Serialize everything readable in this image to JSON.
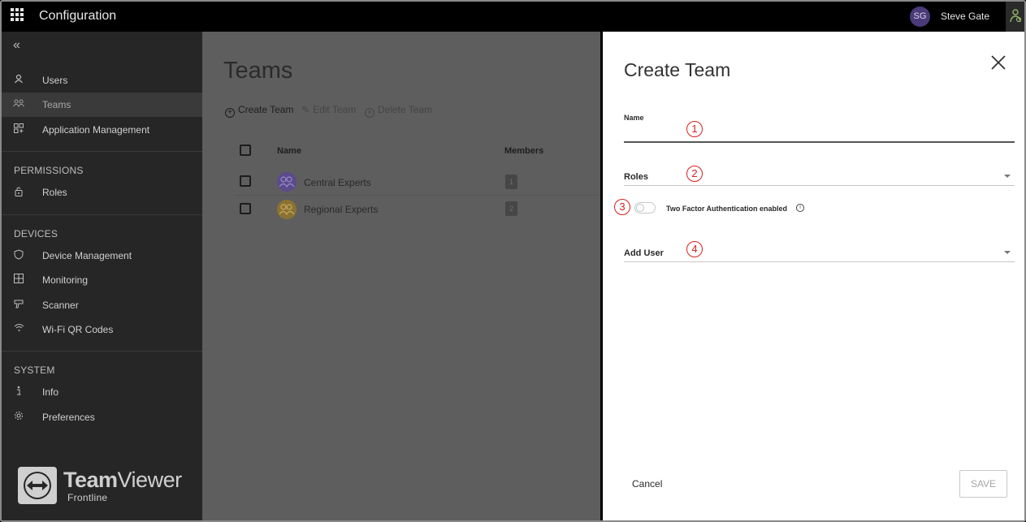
{
  "topbar": {
    "app_title": "Configuration",
    "avatar_initials": "SG",
    "user_name": "Steve Gate"
  },
  "sidebar": {
    "collapse_glyph": "«",
    "items": [
      {
        "label": "Users",
        "icon": "user-icon"
      },
      {
        "label": "Teams",
        "icon": "teams-icon",
        "active": true
      },
      {
        "label": "Application Management",
        "icon": "apps-icon"
      }
    ],
    "sections": [
      {
        "heading": "PERMISSIONS",
        "items": [
          {
            "label": "Roles",
            "icon": "lock-icon"
          }
        ]
      },
      {
        "heading": "DEVICES",
        "items": [
          {
            "label": "Device Management",
            "icon": "shield-icon"
          },
          {
            "label": "Monitoring",
            "icon": "grid-icon"
          },
          {
            "label": "Scanner",
            "icon": "scanner-icon"
          },
          {
            "label": "Wi-Fi QR Codes",
            "icon": "wifi-icon"
          }
        ]
      },
      {
        "heading": "SYSTEM",
        "items": [
          {
            "label": "Info",
            "icon": "info-icon"
          },
          {
            "label": "Preferences",
            "icon": "gear-icon"
          }
        ]
      }
    ],
    "logo": {
      "name_bold": "Team",
      "name_light": "Viewer",
      "sub": "Frontline"
    }
  },
  "main": {
    "page_title": "Teams",
    "toolbar": {
      "create": "Create Team",
      "edit": "Edit Team",
      "delete": "Delete Team"
    },
    "table": {
      "columns": [
        "Name",
        "Members"
      ],
      "rows": [
        {
          "name": "Central Experts",
          "members": "1",
          "avatar_color": "#5b4a8c"
        },
        {
          "name": "Regional Experts",
          "members": "2",
          "avatar_color": "#8c7232"
        }
      ]
    }
  },
  "panel": {
    "title": "Create Team",
    "name_label": "Name",
    "roles_label": "Roles",
    "toggle_label": "Two Factor Authentication enabled",
    "add_user_label": "Add User",
    "cancel_label": "Cancel",
    "save_label": "SAVE",
    "markers": [
      "1",
      "2",
      "3",
      "4"
    ]
  },
  "colors": {
    "topbar": "#000000",
    "sidebar": "#262626",
    "overlay": "#5e5e5e",
    "panel": "#ffffff",
    "marker": "#d62020"
  }
}
